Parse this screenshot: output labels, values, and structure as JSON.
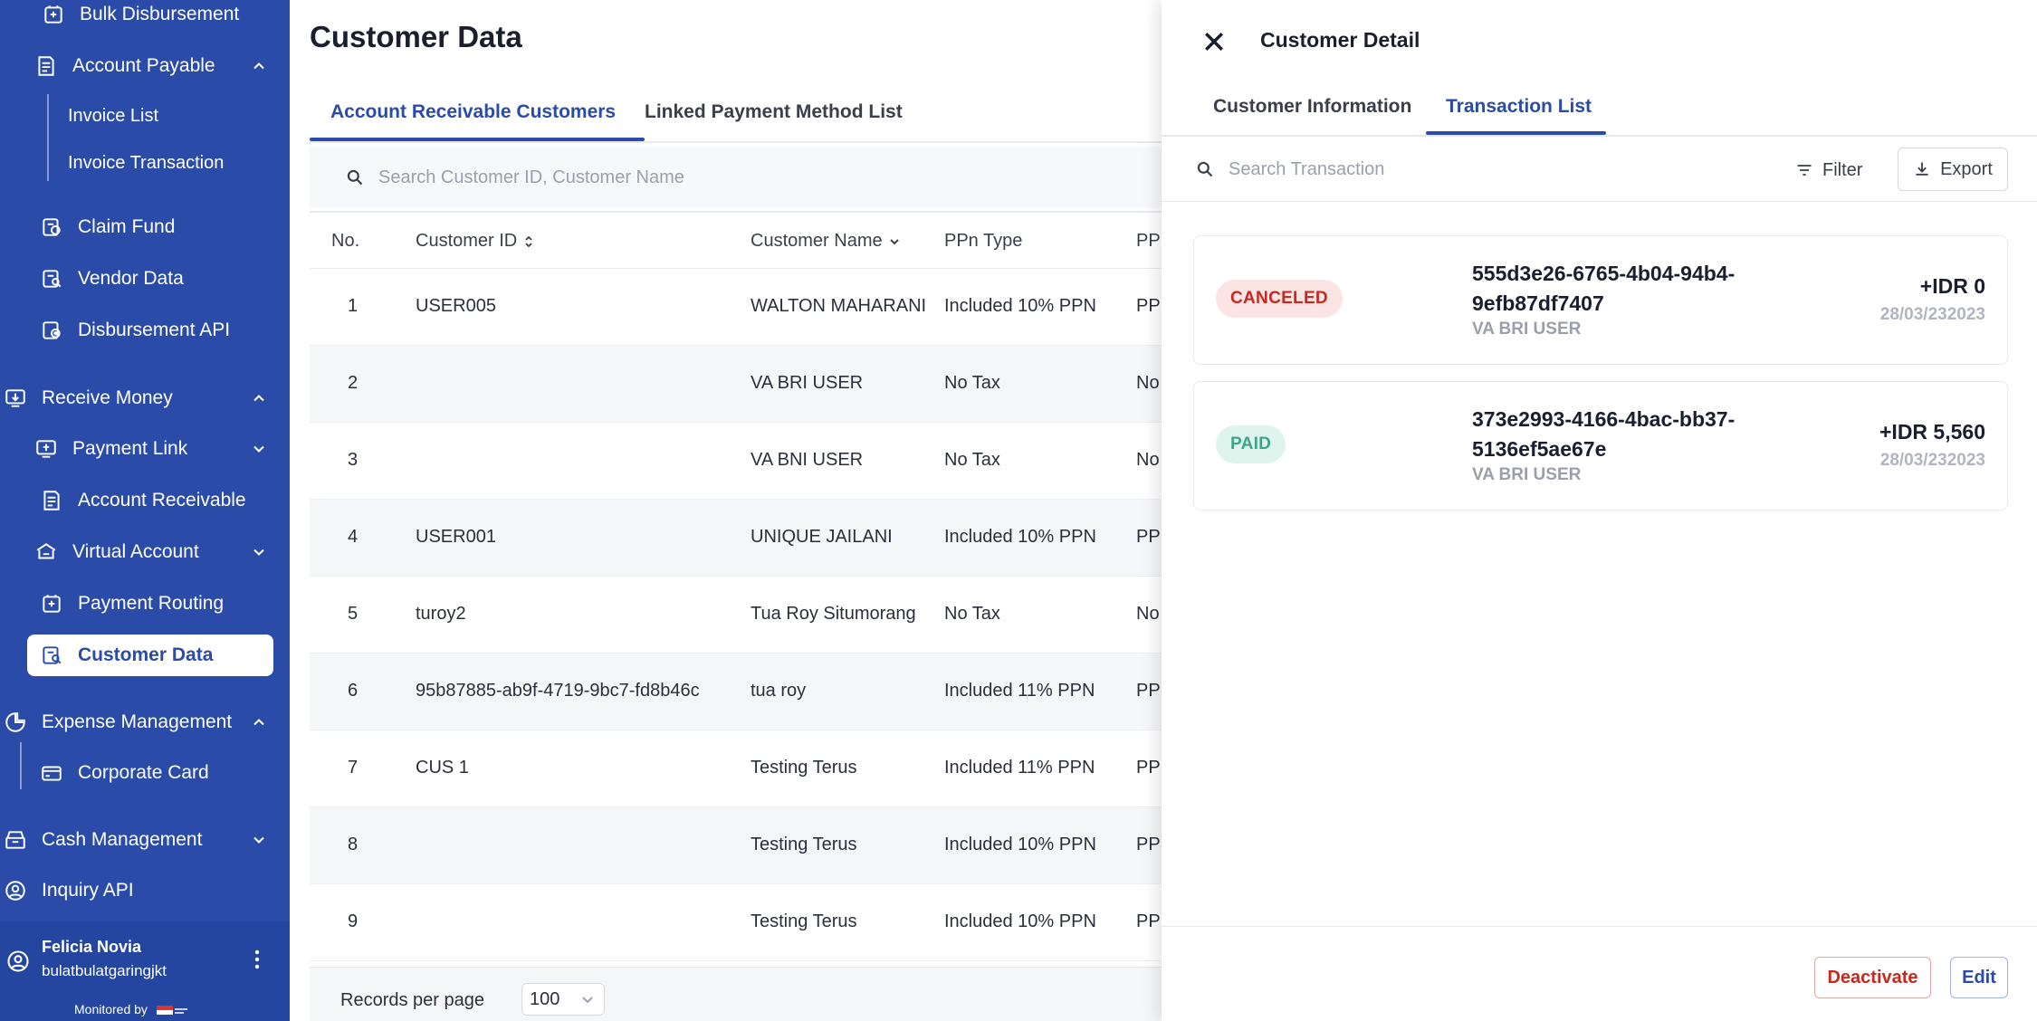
{
  "sidebar": {
    "items": {
      "bulk_disbursement": "Bulk Disbursement",
      "account_payable": "Account Payable",
      "invoice_list": "Invoice List",
      "invoice_transaction": "Invoice Transaction",
      "claim_fund": "Claim Fund",
      "vendor_data": "Vendor Data",
      "disbursement_api": "Disbursement API",
      "receive_money": "Receive Money",
      "payment_link": "Payment Link",
      "account_receivable": "Account Receivable",
      "virtual_account": "Virtual Account",
      "payment_routing": "Payment Routing",
      "customer_data": "Customer Data",
      "expense_management": "Expense Management",
      "corporate_card": "Corporate Card",
      "cash_management": "Cash Management",
      "inquiry_api": "Inquiry API"
    },
    "user": {
      "name": "Felicia Novia",
      "username": "bulatbulatgaringjkt"
    },
    "monitored_by": "Monitored by"
  },
  "main": {
    "title": "Customer Data",
    "tabs": [
      {
        "label": "Account Receivable Customers"
      },
      {
        "label": "Linked Payment Method List"
      }
    ],
    "search_placeholder": "Search Customer ID, Customer Name",
    "columns": {
      "no": "No.",
      "customer_id": "Customer ID",
      "customer_name": "Customer Name",
      "ppn_type": "PPn Type",
      "ppn_cut": "PPI"
    },
    "rows": [
      {
        "no": "1",
        "customer_id": "USER005",
        "customer_name": "WALTON MAHARANI",
        "ppn_type": "Included 10% PPN",
        "ppn_cut": "PPI"
      },
      {
        "no": "2",
        "customer_id": "",
        "customer_name": "VA BRI USER",
        "ppn_type": "No Tax",
        "ppn_cut": "No"
      },
      {
        "no": "3",
        "customer_id": "",
        "customer_name": "VA BNI USER",
        "ppn_type": "No Tax",
        "ppn_cut": "No"
      },
      {
        "no": "4",
        "customer_id": "USER001",
        "customer_name": "UNIQUE JAILANI",
        "ppn_type": "Included 10% PPN",
        "ppn_cut": "PPI"
      },
      {
        "no": "5",
        "customer_id": "turoy2",
        "customer_name": "Tua Roy Situmorang",
        "ppn_type": "No Tax",
        "ppn_cut": "No"
      },
      {
        "no": "6",
        "customer_id": "95b87885-ab9f-4719-9bc7-fd8b46c",
        "customer_name": "tua roy",
        "ppn_type": "Included 11% PPN",
        "ppn_cut": "PPI"
      },
      {
        "no": "7",
        "customer_id": "CUS 1",
        "customer_name": "Testing Terus",
        "ppn_type": "Included 11% PPN",
        "ppn_cut": "PPI"
      },
      {
        "no": "8",
        "customer_id": "",
        "customer_name": "Testing Terus",
        "ppn_type": "Included 10% PPN",
        "ppn_cut": "PPI"
      },
      {
        "no": "9",
        "customer_id": "",
        "customer_name": "Testing Terus",
        "ppn_type": "Included 10% PPN",
        "ppn_cut": "PPI"
      }
    ],
    "pager": {
      "label": "Records per page",
      "value": "100"
    }
  },
  "panel": {
    "title": "Customer Detail",
    "tabs": [
      {
        "label": "Customer Information"
      },
      {
        "label": "Transaction List"
      }
    ],
    "search_placeholder": "Search Transaction",
    "filter_label": "Filter",
    "export_label": "Export",
    "transactions": [
      {
        "status": "CANCELED",
        "id": "555d3e26-6765-4b04-94b4-9efb87df7407",
        "method": "VA BRI USER",
        "amount": "+IDR 0",
        "date": "28/03/232023"
      },
      {
        "status": "PAID",
        "id": "373e2993-4166-4bac-bb37-5136ef5ae67e",
        "method": "VA BRI USER",
        "amount": "+IDR 5,560",
        "date": "28/03/232023"
      }
    ],
    "deactivate_label": "Deactivate",
    "edit_label": "Edit"
  },
  "colors": {
    "sidebar": "#2a4ca8",
    "accent": "#2a4ca8",
    "danger": "#c8281e",
    "success": "#3ba687"
  }
}
